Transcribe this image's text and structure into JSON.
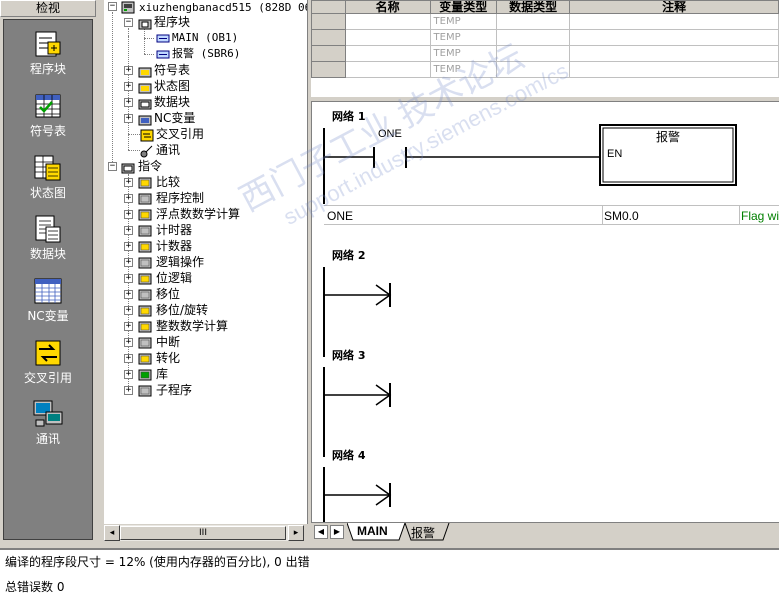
{
  "view_bar": {
    "title": "检视",
    "items": [
      {
        "label": "程序块",
        "icon": "program-block-icon"
      },
      {
        "label": "符号表",
        "icon": "symbol-table-icon"
      },
      {
        "label": "状态图",
        "icon": "status-chart-icon"
      },
      {
        "label": "数据块",
        "icon": "data-block-icon"
      },
      {
        "label": "NC变量",
        "icon": "nc-variable-icon"
      },
      {
        "label": "交叉引用",
        "icon": "cross-reference-icon"
      },
      {
        "label": "通讯",
        "icon": "communication-icon"
      }
    ]
  },
  "tree": {
    "project": "xiuzhengbanacd515 (828D 06.",
    "program_block": "程序块",
    "main": "MAIN (OB1)",
    "alarm_sub": "报警 (SBR6)",
    "symbol_table": "符号表",
    "status_chart": "状态图",
    "data_block": "数据块",
    "nc_variable": "NC变量",
    "cross_ref": "交叉引用",
    "comm": "通讯",
    "instructions": "指令",
    "instr_items": [
      "比较",
      "程序控制",
      "浮点数数学计算",
      "计时器",
      "计数器",
      "逻辑操作",
      "位逻辑",
      "移位",
      "移位/旋转",
      "整数数学计算",
      "中断",
      "转化",
      "库",
      "子程序"
    ],
    "hscroll_thumb": "III"
  },
  "symbol_table": {
    "headers": [
      "名称",
      "变量类型",
      "数据类型",
      "注释"
    ],
    "rows": [
      {
        "var_type": "TEMP"
      },
      {
        "var_type": "TEMP"
      },
      {
        "var_type": "TEMP"
      },
      {
        "var_type": "TEMP"
      }
    ]
  },
  "editor": {
    "networks": [
      "网络 1",
      "网络 2",
      "网络 3",
      "网络 4"
    ],
    "contact_label": "ONE",
    "box_title": "报警",
    "box_en": "EN",
    "symbol_row": {
      "name": "ONE",
      "address": "SM0.0",
      "comment": "Flag wi"
    }
  },
  "tabs": [
    "MAIN",
    "报警"
  ],
  "output": {
    "line1": "编译的程序段尺寸 = 12% (使用内存器的百分比), 0 出错",
    "line2": "总错误数 0"
  },
  "watermark": {
    "text1": "西门子工业 技术论坛",
    "text2": "support.industry.siemens.com/cs"
  },
  "colors": {
    "comment_green": "#008000",
    "view_bar_bg": "#808080"
  }
}
